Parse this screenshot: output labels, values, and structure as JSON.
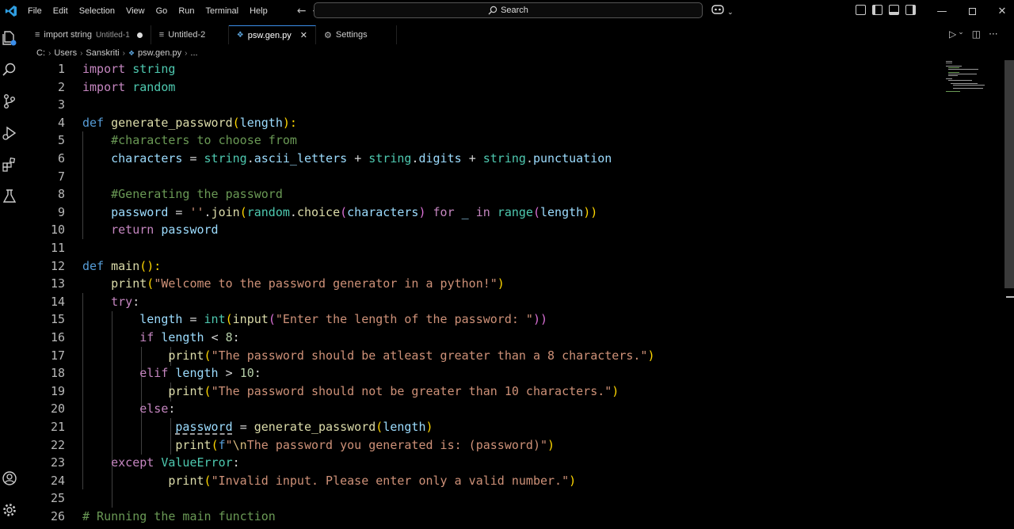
{
  "menu": [
    "File",
    "Edit",
    "Selection",
    "View",
    "Go",
    "Run",
    "Terminal",
    "Help"
  ],
  "search": {
    "label": "Search"
  },
  "tabs": [
    {
      "label": "import string",
      "sub": "Untitled-1",
      "modified": true
    },
    {
      "label": "Untitled-2",
      "sub": ""
    },
    {
      "label": "psw.gen.py",
      "sub": "",
      "active": true
    },
    {
      "label": "Settings",
      "sub": ""
    }
  ],
  "breadcrumb": [
    "C:",
    "Users",
    "Sanskriti",
    "psw.gen.py",
    "..."
  ],
  "lines": [
    {
      "n": "1"
    },
    {
      "n": "2"
    },
    {
      "n": "3"
    },
    {
      "n": "4"
    },
    {
      "n": "5"
    },
    {
      "n": "6"
    },
    {
      "n": "7"
    },
    {
      "n": "8"
    },
    {
      "n": "9"
    },
    {
      "n": "10"
    },
    {
      "n": "11"
    },
    {
      "n": "12"
    },
    {
      "n": "13"
    },
    {
      "n": "14"
    },
    {
      "n": "15"
    },
    {
      "n": "16"
    },
    {
      "n": "17"
    },
    {
      "n": "18"
    },
    {
      "n": "19"
    },
    {
      "n": "20"
    },
    {
      "n": "21"
    },
    {
      "n": "22"
    },
    {
      "n": "23"
    },
    {
      "n": "24"
    },
    {
      "n": "25"
    },
    {
      "n": "26"
    }
  ],
  "code": {
    "l1": [
      "import",
      "string"
    ],
    "l2": [
      "import",
      "random"
    ],
    "l4": [
      "def",
      "generate_password",
      "(",
      "length",
      "):"
    ],
    "l5": "#characters to choose from",
    "l6": [
      "characters",
      "=",
      "string",
      ".",
      "ascii_letters",
      "+",
      "string",
      ".",
      "digits",
      "+",
      "string",
      ".",
      "punctuation"
    ],
    "l8": "#Generating the password",
    "l9": [
      "password",
      "=",
      "''",
      ".",
      "join",
      "(",
      "random",
      ".",
      "choice",
      "(",
      "characters",
      ")",
      "for",
      "_",
      "in",
      "range",
      "(",
      "length",
      "))"
    ],
    "l10": [
      "return",
      "password"
    ],
    "l12": [
      "def",
      "main",
      "():"
    ],
    "l13": [
      "print",
      "(",
      "\"Welcome to the password generator in a python!\"",
      ")"
    ],
    "l14": [
      "try",
      ":"
    ],
    "l15": [
      "length",
      "=",
      "int",
      "(",
      "input",
      "(",
      "\"Enter the length of the password: \"",
      "))"
    ],
    "l16": [
      "if",
      "length",
      "<",
      "8",
      ":"
    ],
    "l17": [
      "print",
      "(",
      "\"The password should be atleast greater than a 8 characters.\"",
      ")"
    ],
    "l18": [
      "elif",
      "length",
      ">",
      "10",
      ":"
    ],
    "l19": [
      "print",
      "(",
      "\"The password should not be greater than 10 characters.\"",
      ")"
    ],
    "l20": [
      "else",
      ":"
    ],
    "l21": [
      "password",
      "=",
      "generate_password",
      "(",
      "length",
      ")"
    ],
    "l22": [
      "print",
      "(",
      "f",
      "\"",
      "\\n",
      "The password you generated is: (password)\"",
      ")"
    ],
    "l23": [
      "except",
      "ValueError",
      ":"
    ],
    "l24": [
      "print",
      "(",
      "\"Invalid input. Please enter only a valid number.\"",
      ")"
    ],
    "l26": "# Running the main function"
  },
  "colors": {
    "keyword": "#c586c0",
    "def": "#569cd6",
    "function": "#dcdcaa",
    "variable": "#9cdcfe",
    "string": "#ce9178",
    "number": "#b5cea8",
    "comment": "#6a9955",
    "accent": "#3b8eea"
  }
}
